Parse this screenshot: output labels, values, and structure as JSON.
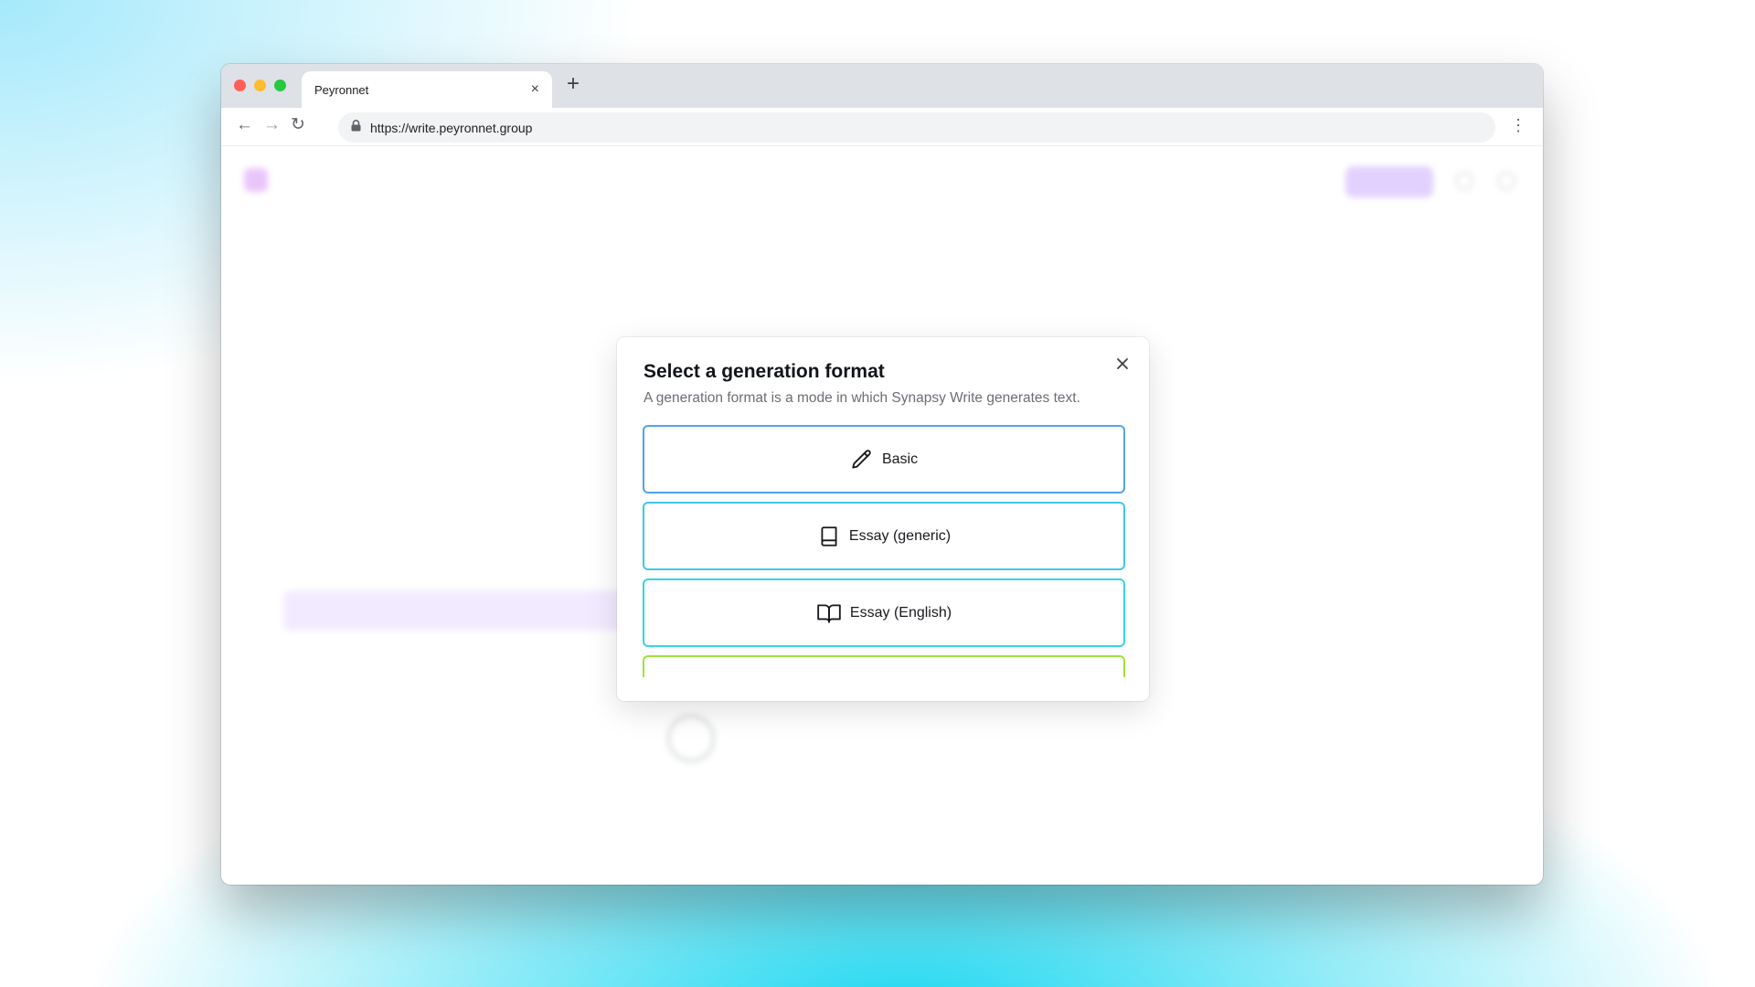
{
  "browser": {
    "tab_title": "Peyronnet",
    "tab_close": "×",
    "new_tab": "+",
    "url": "https://write.peyronnet.group",
    "back": "←",
    "forward": "→",
    "reload": "↻",
    "menu": "⋮"
  },
  "modal": {
    "title": "Select a generation format",
    "description": "A generation format is a mode in which Synapsy Write generates text.",
    "close_icon": "close-icon",
    "options": [
      {
        "label": "Basic",
        "icon": "pencil-icon",
        "border": "#4fa3ef"
      },
      {
        "label": "Essay (generic)",
        "icon": "book-icon",
        "border": "#3fc7ea"
      },
      {
        "label": "Essay (English)",
        "icon": "book-open-icon",
        "border": "#37d3e5"
      },
      {
        "label": "",
        "icon": "",
        "border": "#9fe23a"
      }
    ]
  },
  "colors": {
    "accent_purple": "#c6a3ff",
    "background_cyan": "#18d6f0"
  }
}
